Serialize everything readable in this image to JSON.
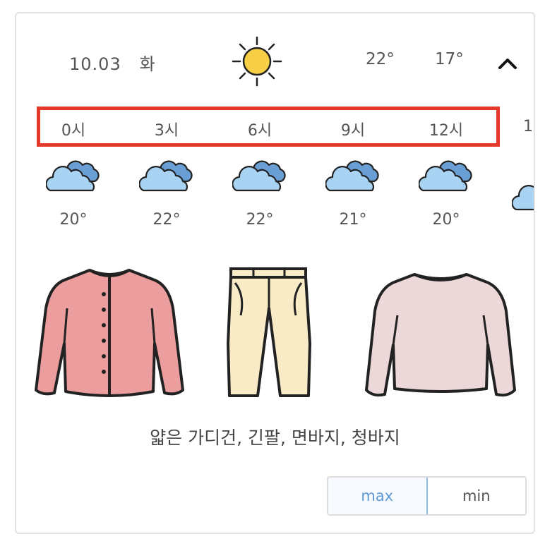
{
  "summary": {
    "date": "10.03",
    "weekday": "화",
    "weather_icon": "sun-icon",
    "temp_max": "22°",
    "temp_min": "17°",
    "collapse_icon": "chevron-up-icon"
  },
  "hourly": [
    {
      "time": "0시",
      "icon": "cloud-icon",
      "temp": "20°"
    },
    {
      "time": "3시",
      "icon": "cloud-icon",
      "temp": "22°"
    },
    {
      "time": "6시",
      "icon": "cloud-icon",
      "temp": "22°"
    },
    {
      "time": "9시",
      "icon": "cloud-icon",
      "temp": "21°"
    },
    {
      "time": "12시",
      "icon": "cloud-icon",
      "temp": "20°"
    }
  ],
  "clothing": {
    "items": [
      "cardigan-icon",
      "pants-icon",
      "sweater-icon"
    ],
    "recommendation": "얇은 가디건, 긴팔, 면바지, 청바지"
  },
  "toggle": {
    "max_label": "max",
    "min_label": "min",
    "selected": "max"
  },
  "colors": {
    "highlight": "#e53a2a",
    "sun": "#f7cf47",
    "cloud": "#a9d3f3",
    "cloud_dark": "#6a9fd6",
    "cardigan": "#ec9e9e",
    "pants": "#f8ebc6",
    "sweater": "#ecd7d9",
    "active_toggle": "#5d9ad8"
  }
}
